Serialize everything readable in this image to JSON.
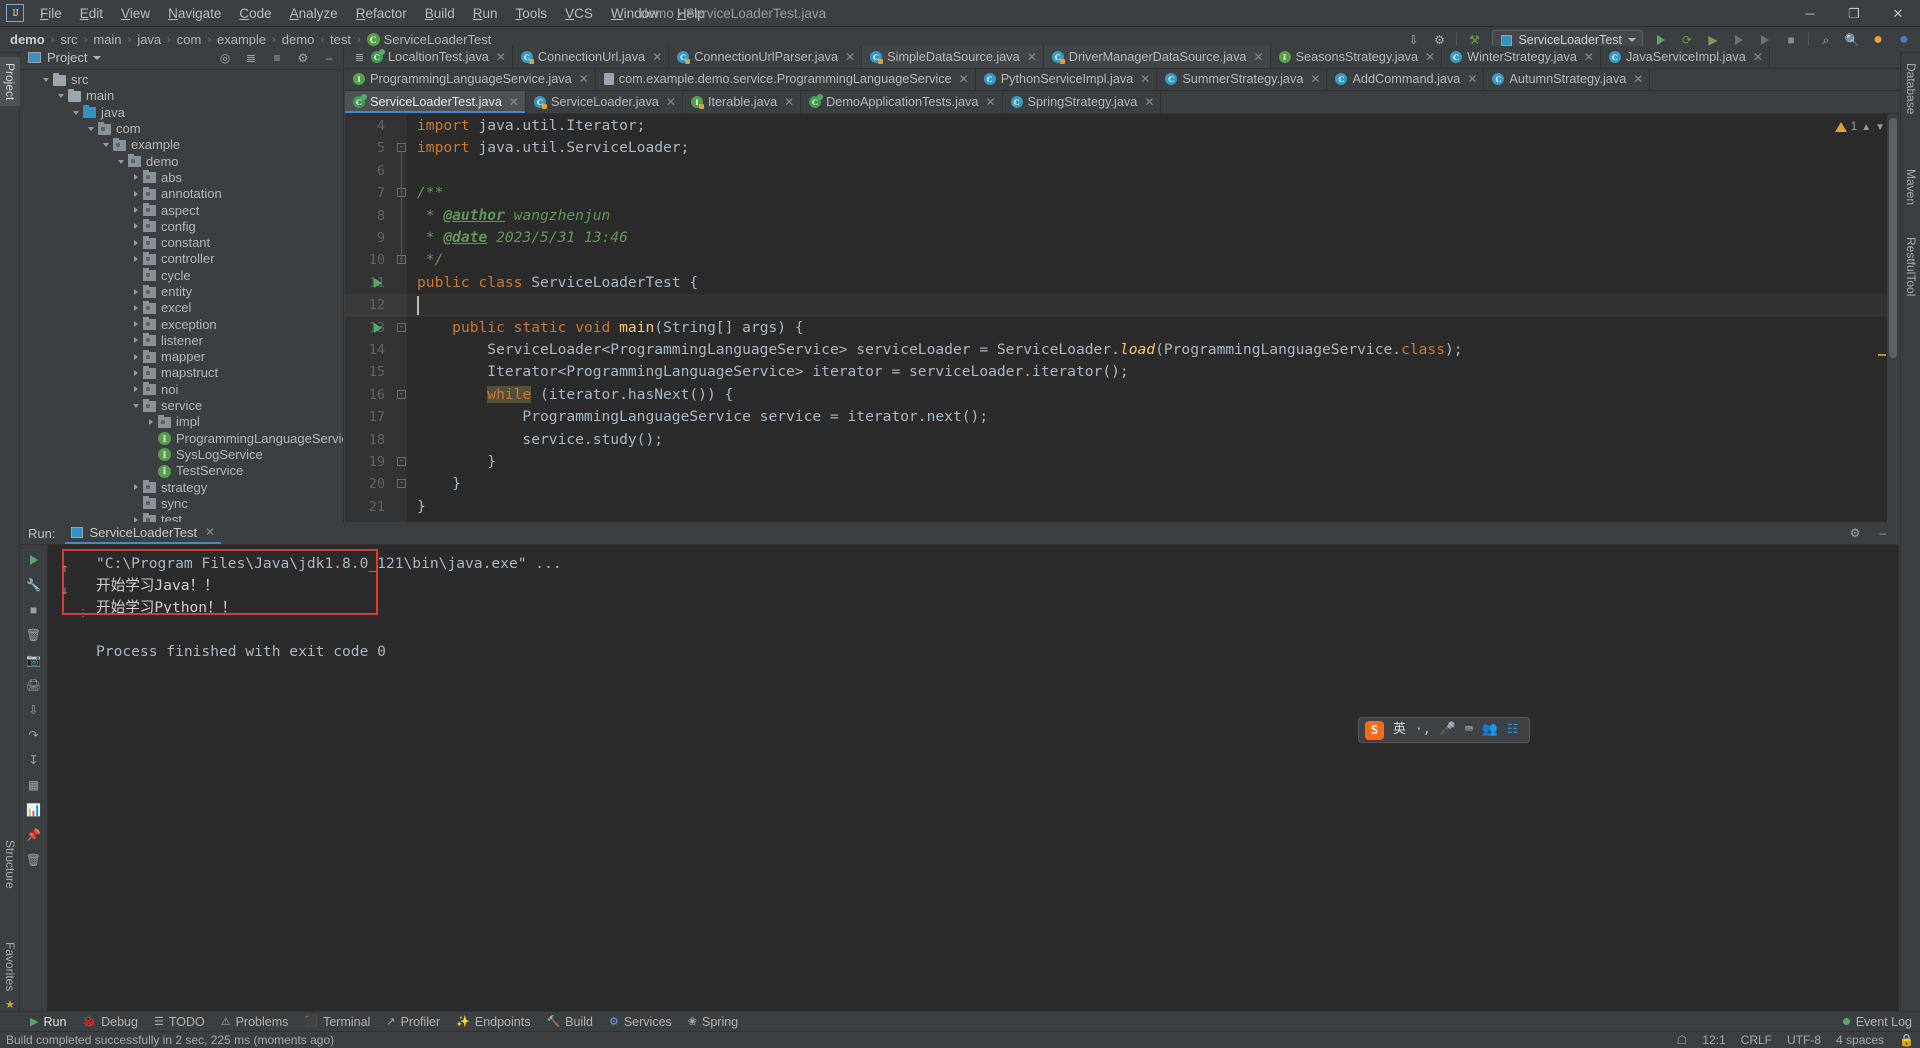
{
  "titlebar": {
    "logo": "IJ",
    "menus": [
      "File",
      "Edit",
      "View",
      "Navigate",
      "Code",
      "Analyze",
      "Refactor",
      "Build",
      "Run",
      "Tools",
      "VCS",
      "Window",
      "Help"
    ],
    "window_title": "demo - ServiceLoaderTest.java",
    "controls": {
      "minimize": "─",
      "maximize": "❐",
      "close": "✕"
    }
  },
  "navbar": {
    "crumbs": [
      "demo",
      "src",
      "main",
      "java",
      "com",
      "example",
      "demo",
      "test",
      "ServiceLoaderTest"
    ],
    "separator": "›",
    "run_config": "ServiceLoaderTest"
  },
  "left_stripe": {
    "tabs": [
      "Project",
      "Structure",
      "Favorites"
    ]
  },
  "right_stripe": {
    "tabs": [
      "Database",
      "Maven",
      "RestfulTool"
    ]
  },
  "project_panel": {
    "title": "Project",
    "tree": [
      {
        "label": "src",
        "indent": 1,
        "arrow": "open",
        "icon": "folder"
      },
      {
        "label": "main",
        "indent": 2,
        "arrow": "open",
        "icon": "folder"
      },
      {
        "label": "java",
        "indent": 3,
        "arrow": "open",
        "icon": "src"
      },
      {
        "label": "com",
        "indent": 4,
        "arrow": "open",
        "icon": "pkg"
      },
      {
        "label": "example",
        "indent": 5,
        "arrow": "open",
        "icon": "pkg"
      },
      {
        "label": "demo",
        "indent": 6,
        "arrow": "open",
        "icon": "pkg"
      },
      {
        "label": "abs",
        "indent": 7,
        "arrow": "closed",
        "icon": "pkg"
      },
      {
        "label": "annotation",
        "indent": 7,
        "arrow": "closed",
        "icon": "pkg"
      },
      {
        "label": "aspect",
        "indent": 7,
        "arrow": "closed",
        "icon": "pkg"
      },
      {
        "label": "config",
        "indent": 7,
        "arrow": "closed",
        "icon": "pkg"
      },
      {
        "label": "constant",
        "indent": 7,
        "arrow": "closed",
        "icon": "pkg"
      },
      {
        "label": "controller",
        "indent": 7,
        "arrow": "closed",
        "icon": "pkg"
      },
      {
        "label": "cycle",
        "indent": 7,
        "arrow": "none",
        "icon": "pkg"
      },
      {
        "label": "entity",
        "indent": 7,
        "arrow": "closed",
        "icon": "pkg"
      },
      {
        "label": "excel",
        "indent": 7,
        "arrow": "closed",
        "icon": "pkg"
      },
      {
        "label": "exception",
        "indent": 7,
        "arrow": "closed",
        "icon": "pkg"
      },
      {
        "label": "listener",
        "indent": 7,
        "arrow": "closed",
        "icon": "pkg"
      },
      {
        "label": "mapper",
        "indent": 7,
        "arrow": "closed",
        "icon": "pkg"
      },
      {
        "label": "mapstruct",
        "indent": 7,
        "arrow": "closed",
        "icon": "pkg"
      },
      {
        "label": "noi",
        "indent": 7,
        "arrow": "closed",
        "icon": "pkg"
      },
      {
        "label": "service",
        "indent": 7,
        "arrow": "open",
        "icon": "pkg"
      },
      {
        "label": "impl",
        "indent": 8,
        "arrow": "closed",
        "icon": "pkg"
      },
      {
        "label": "ProgrammingLanguageService",
        "indent": 8,
        "arrow": "none",
        "icon": "iface"
      },
      {
        "label": "SysLogService",
        "indent": 8,
        "arrow": "none",
        "icon": "iface"
      },
      {
        "label": "TestService",
        "indent": 8,
        "arrow": "none",
        "icon": "iface"
      },
      {
        "label": "strategy",
        "indent": 7,
        "arrow": "closed",
        "icon": "pkg"
      },
      {
        "label": "sync",
        "indent": 7,
        "arrow": "none",
        "icon": "pkg"
      },
      {
        "label": "test",
        "indent": 7,
        "arrow": "closed",
        "icon": "pkg"
      }
    ]
  },
  "editor_tabs": {
    "row1": [
      {
        "label": "LocaltionTest.java",
        "icon": "g",
        "state": "inactive",
        "lock": false
      },
      {
        "label": "ConnectionUrl.java",
        "icon": "c",
        "state": "inactive",
        "lock": true
      },
      {
        "label": "ConnectionUrlParser.java",
        "icon": "c",
        "state": "inactive",
        "lock": true
      },
      {
        "label": "SimpleDataSource.java",
        "icon": "c",
        "state": "dim",
        "lock": true
      },
      {
        "label": "DriverManagerDataSource.java",
        "icon": "c",
        "state": "dim",
        "lock": true
      },
      {
        "label": "SeasonsStrategy.java",
        "icon": "i",
        "state": "inactive",
        "lock": false
      },
      {
        "label": "WinterStrategy.java",
        "icon": "c",
        "state": "inactive",
        "lock": false
      },
      {
        "label": "JavaServiceImpl.java",
        "icon": "c",
        "state": "inactive",
        "lock": false
      }
    ],
    "row2": [
      {
        "label": "ProgrammingLanguageService.java",
        "icon": "i",
        "state": "inactive",
        "lock": false
      },
      {
        "label": "com.example.demo.service.ProgrammingLanguageService",
        "icon": "txt",
        "state": "inactive",
        "lock": false
      },
      {
        "label": "PythonServiceImpl.java",
        "icon": "c",
        "state": "inactive",
        "lock": false
      },
      {
        "label": "SummerStrategy.java",
        "icon": "c",
        "state": "inactive",
        "lock": false
      },
      {
        "label": "AddCommand.java",
        "icon": "c",
        "state": "inactive",
        "lock": false
      },
      {
        "label": "AutumnStrategy.java",
        "icon": "c",
        "state": "inactive",
        "lock": false
      }
    ],
    "row3": [
      {
        "label": "ServiceLoaderTest.java",
        "icon": "g",
        "state": "active",
        "lock": false
      },
      {
        "label": "ServiceLoader.java",
        "icon": "c",
        "state": "inactive",
        "lock": true
      },
      {
        "label": "Iterable.java",
        "icon": "i",
        "state": "inactive",
        "lock": true
      },
      {
        "label": "DemoApplicationTests.java",
        "icon": "g",
        "state": "inactive",
        "lock": false
      },
      {
        "label": "SpringStrategy.java",
        "icon": "c",
        "state": "inactive",
        "lock": false
      }
    ],
    "close_glyph": "✕"
  },
  "editor": {
    "warning_count": "1",
    "first_line_number": 4,
    "lines": [
      {
        "n": 4,
        "indent": 0,
        "text": "import java.util.Iterator;"
      },
      {
        "n": 5,
        "indent": 0,
        "text": "import java.util.ServiceLoader;"
      },
      {
        "n": 6,
        "indent": 0,
        "text": ""
      },
      {
        "n": 7,
        "indent": 0,
        "text": "/**"
      },
      {
        "n": 8,
        "indent": 0,
        "text": " * @author wangzhenjun"
      },
      {
        "n": 9,
        "indent": 0,
        "text": " * @date 2023/5/31 13:46"
      },
      {
        "n": 10,
        "indent": 0,
        "text": " */"
      },
      {
        "n": 11,
        "indent": 0,
        "text": "public class ServiceLoaderTest {"
      },
      {
        "n": 12,
        "indent": 0,
        "text": ""
      },
      {
        "n": 13,
        "indent": 1,
        "text": "public static void main(String[] args) {"
      },
      {
        "n": 14,
        "indent": 2,
        "text": "ServiceLoader<ProgrammingLanguageService> serviceLoader = ServiceLoader.load(ProgrammingLanguageService.class);"
      },
      {
        "n": 15,
        "indent": 2,
        "text": "Iterator<ProgrammingLanguageService> iterator = serviceLoader.iterator();"
      },
      {
        "n": 16,
        "indent": 2,
        "text": "while (iterator.hasNext()) {"
      },
      {
        "n": 17,
        "indent": 3,
        "text": "ProgrammingLanguageService service = iterator.next();"
      },
      {
        "n": 18,
        "indent": 3,
        "text": "service.study();"
      },
      {
        "n": 19,
        "indent": 2,
        "text": "}"
      },
      {
        "n": 20,
        "indent": 1,
        "text": "}"
      },
      {
        "n": 21,
        "indent": 0,
        "text": "}"
      }
    ],
    "caret_line": 12,
    "run_marker_lines": [
      11,
      13
    ],
    "colors": {
      "keyword": "#cc7832",
      "string": "#6a8759",
      "comment": "#629755",
      "method": "#ffc66d",
      "text": "#a9b7c6"
    }
  },
  "run_panel": {
    "label": "Run:",
    "tab_title": "ServiceLoaderTest",
    "close_glyph": "✕",
    "console_lines": [
      {
        "text": "\"C:\\Program Files\\Java\\jdk1.8.0_121\\bin\\java.exe\" ...",
        "style": "gray"
      },
      {
        "text": "开始学习Java！！",
        "style": "white"
      },
      {
        "text": "开始学习Python！！",
        "style": "white"
      },
      {
        "text": "",
        "style": "gray"
      },
      {
        "text": "Process finished with exit code 0",
        "style": "gray"
      }
    ],
    "highlight_color": "#e03a34"
  },
  "ime_bar": {
    "logo": "S",
    "mode": "英",
    "items": [
      "punct-icon",
      "mic-icon",
      "keyboard-icon",
      "user-icon",
      "apps-icon"
    ]
  },
  "bottom_bar": {
    "items": [
      {
        "label": "Run",
        "icon": "run-icon",
        "selected": true
      },
      {
        "label": "Debug",
        "icon": "debug-icon",
        "selected": false
      },
      {
        "label": "TODO",
        "icon": "todo-icon",
        "selected": false
      },
      {
        "label": "Problems",
        "icon": "problems-icon",
        "selected": false
      },
      {
        "label": "Terminal",
        "icon": "terminal-icon",
        "selected": false
      },
      {
        "label": "Profiler",
        "icon": "profiler-icon",
        "selected": false
      },
      {
        "label": "Endpoints",
        "icon": "endpoints-icon",
        "selected": false
      },
      {
        "label": "Build",
        "icon": "build-icon",
        "selected": false
      },
      {
        "label": "Services",
        "icon": "services-icon",
        "selected": false
      },
      {
        "label": "Spring",
        "icon": "spring-icon",
        "selected": false
      }
    ],
    "event_log": "Event Log"
  },
  "statusbar": {
    "message": "Build completed successfully in 2 sec, 225 ms (moments ago)",
    "caret_pos": "12:1",
    "line_sep": "CRLF",
    "encoding": "UTF-8",
    "indent": "4 spaces"
  }
}
